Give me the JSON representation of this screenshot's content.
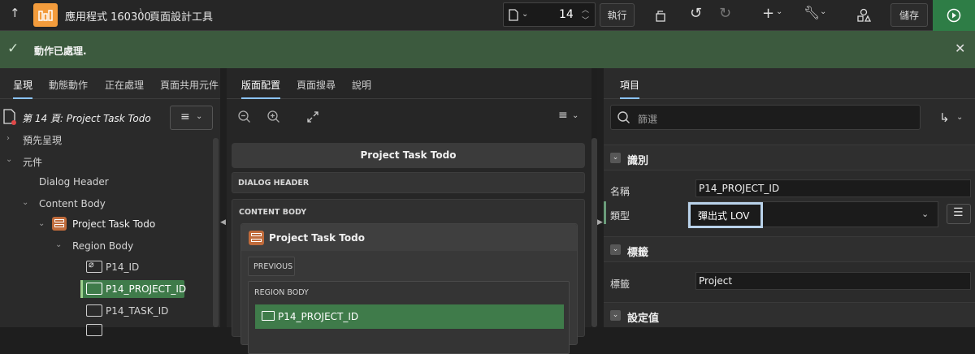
{
  "topbar": {
    "app_label": "應用程式 160300",
    "separator": "\\",
    "page_designer_label": "頁面設計工具",
    "page_number": "14",
    "run_label": "執行",
    "save_label": "儲存"
  },
  "message": {
    "text": "動作已處理."
  },
  "left": {
    "tabs": [
      {
        "label": "呈現"
      },
      {
        "label": "動態動作"
      },
      {
        "label": "正在處理"
      },
      {
        "label": "頁面共用元件"
      }
    ],
    "page_title": "第 14 頁: Project Task Todo",
    "tree": {
      "preview": "預先呈現",
      "components": "元件",
      "dialog_header": "Dialog Header",
      "content_body": "Content Body",
      "region": "Project Task Todo",
      "region_body": "Region Body",
      "items": [
        {
          "label": "P14_ID"
        },
        {
          "label": "P14_PROJECT_ID"
        },
        {
          "label": "P14_TASK_ID"
        }
      ]
    }
  },
  "middle": {
    "tabs": [
      {
        "label": "版面配置"
      },
      {
        "label": "頁面搜尋"
      },
      {
        "label": "說明"
      }
    ],
    "page_header": "Project Task Todo",
    "dialog_header": "DIALOG HEADER",
    "content_body": "CONTENT BODY",
    "region_title": "Project Task Todo",
    "previous": "PREVIOUS",
    "region_body": "REGION BODY",
    "selected_item": "P14_PROJECT_ID"
  },
  "right": {
    "tabs": [
      {
        "label": "項目"
      }
    ],
    "filter_placeholder": "篩選",
    "sections": {
      "identification": "識別",
      "label": "標籤",
      "default": "設定值"
    },
    "fields": {
      "name_label": "名稱",
      "name_value": "P14_PROJECT_ID",
      "type_label": "類型",
      "type_value": "彈出式 LOV",
      "label_label": "標籤",
      "label_value": "Project"
    }
  },
  "colors": {
    "accent_orange": "#f39c3c",
    "success_green": "#3c5a3e",
    "selected_green": "#3f7b4a",
    "run_green": "#2e7d46"
  }
}
